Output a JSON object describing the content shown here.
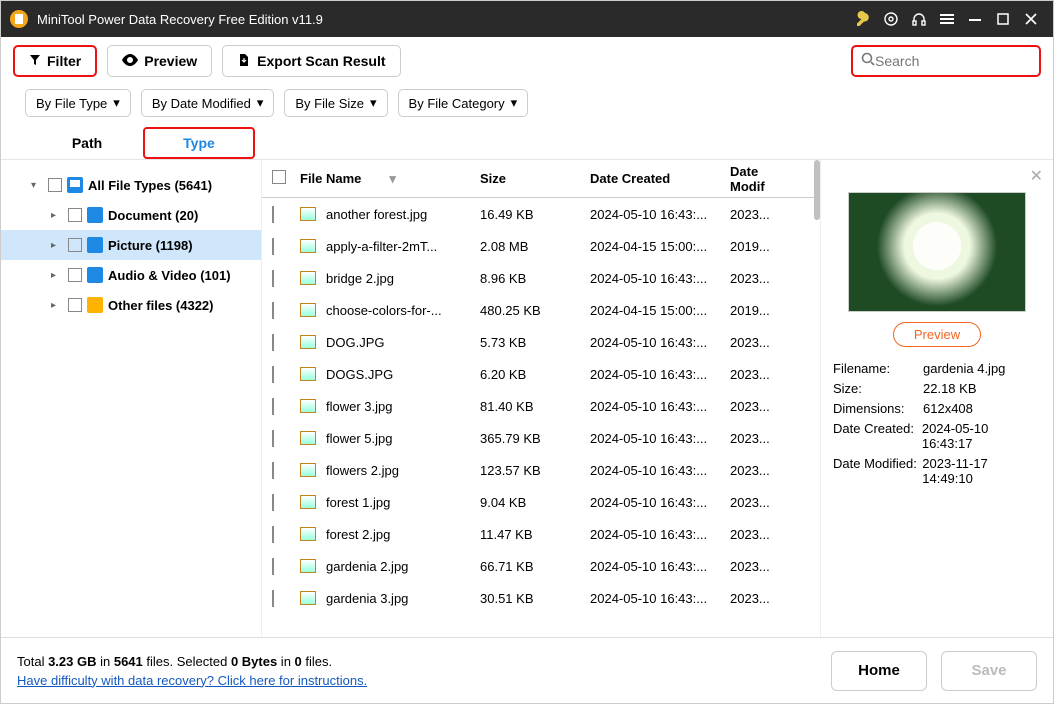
{
  "titlebar": {
    "title": "MiniTool Power Data Recovery Free Edition v11.9"
  },
  "toolbar": {
    "filter_label": "Filter",
    "preview_label": "Preview",
    "export_label": "Export Scan Result",
    "search_placeholder": "Search"
  },
  "chips": [
    "By File Type",
    "By Date Modified",
    "By File Size",
    "By File Category"
  ],
  "tabs": {
    "path": "Path",
    "type": "Type"
  },
  "tree": {
    "root": "All File Types (5641)",
    "items": [
      {
        "label": "Document (20)",
        "icon": "doc"
      },
      {
        "label": "Picture (1198)",
        "icon": "pic",
        "selected": true
      },
      {
        "label": "Audio & Video (101)",
        "icon": "av"
      },
      {
        "label": "Other files (4322)",
        "icon": "folder"
      }
    ]
  },
  "table": {
    "headers": {
      "name": "File Name",
      "size": "Size",
      "created": "Date Created",
      "modified": "Date Modif"
    },
    "rows": [
      {
        "name": "another forest.jpg",
        "size": "16.49 KB",
        "created": "2024-05-10 16:43:...",
        "modified": "2023..."
      },
      {
        "name": "apply-a-filter-2mT...",
        "size": "2.08 MB",
        "created": "2024-04-15 15:00:...",
        "modified": "2019..."
      },
      {
        "name": "bridge 2.jpg",
        "size": "8.96 KB",
        "created": "2024-05-10 16:43:...",
        "modified": "2023..."
      },
      {
        "name": "choose-colors-for-...",
        "size": "480.25 KB",
        "created": "2024-04-15 15:00:...",
        "modified": "2019..."
      },
      {
        "name": "DOG.JPG",
        "size": "5.73 KB",
        "created": "2024-05-10 16:43:...",
        "modified": "2023..."
      },
      {
        "name": "DOGS.JPG",
        "size": "6.20 KB",
        "created": "2024-05-10 16:43:...",
        "modified": "2023..."
      },
      {
        "name": "flower 3.jpg",
        "size": "81.40 KB",
        "created": "2024-05-10 16:43:...",
        "modified": "2023..."
      },
      {
        "name": "flower 5.jpg",
        "size": "365.79 KB",
        "created": "2024-05-10 16:43:...",
        "modified": "2023..."
      },
      {
        "name": "flowers 2.jpg",
        "size": "123.57 KB",
        "created": "2024-05-10 16:43:...",
        "modified": "2023..."
      },
      {
        "name": "forest 1.jpg",
        "size": "9.04 KB",
        "created": "2024-05-10 16:43:...",
        "modified": "2023..."
      },
      {
        "name": "forest 2.jpg",
        "size": "11.47 KB",
        "created": "2024-05-10 16:43:...",
        "modified": "2023..."
      },
      {
        "name": "gardenia 2.jpg",
        "size": "66.71 KB",
        "created": "2024-05-10 16:43:...",
        "modified": "2023..."
      },
      {
        "name": "gardenia 3.jpg",
        "size": "30.51 KB",
        "created": "2024-05-10 16:43:...",
        "modified": "2023..."
      }
    ]
  },
  "preview": {
    "button": "Preview",
    "meta": {
      "filename_k": "Filename:",
      "filename_v": "gardenia 4.jpg",
      "size_k": "Size:",
      "size_v": "22.18 KB",
      "dim_k": "Dimensions:",
      "dim_v": "612x408",
      "created_k": "Date Created:",
      "created_v": "2024-05-10 16:43:17",
      "modified_k": "Date Modified:",
      "modified_v": "2023-11-17 14:49:10"
    }
  },
  "status": {
    "total_prefix": "Total ",
    "total_size": "3.23 GB",
    "total_in": " in ",
    "total_count": "5641",
    "total_suffix": " files.   ",
    "sel_prefix": "Selected ",
    "sel_bytes": "0 Bytes",
    "sel_in": " in ",
    "sel_count": "0",
    "sel_suffix": " files.",
    "help_link": "Have difficulty with data recovery? Click here for instructions.",
    "home": "Home",
    "save": "Save"
  }
}
